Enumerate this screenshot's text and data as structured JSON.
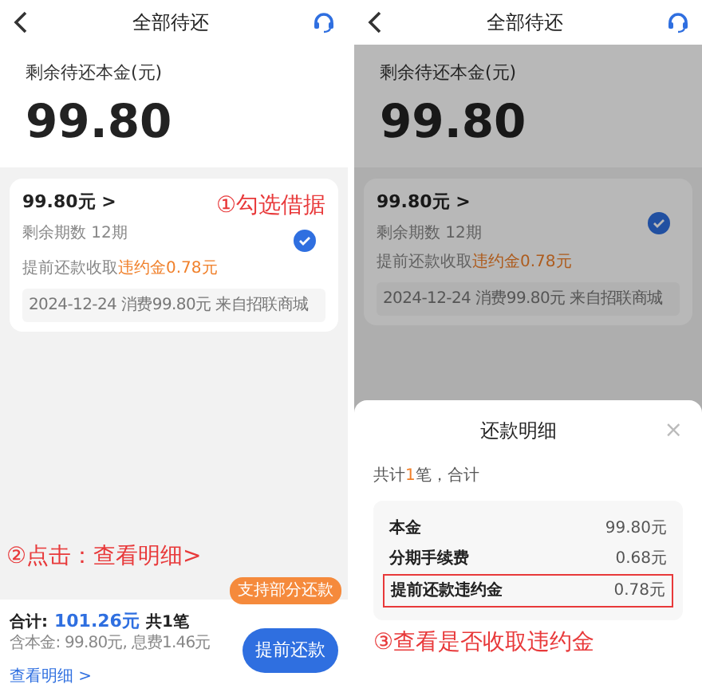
{
  "screens": [
    {
      "dimmed": false,
      "title": "全部待还",
      "summary": {
        "label": "剩余待还本金(元)",
        "amount": "99.80"
      },
      "loan": {
        "amount": "99.80元",
        "caret": ">",
        "periods": "剩余期数 12期",
        "fee_text": "提前还款收取",
        "fee_value": "违约金0.78元",
        "checked": true,
        "detail": "2024-12-24 消费99.80元 来自招联商城"
      },
      "card_annotation": "①勾选借据",
      "bottom_annotation": "②点击：查看明细>",
      "bottom_bar": {
        "total_label": "合计:",
        "total": "101.26元",
        "count": "共1笔",
        "breakdown": "含本金: 99.80元, 息费1.46元",
        "detail_link": "查看明细 >",
        "badge": "支持部分还款",
        "button": "提前还款"
      }
    },
    {
      "dimmed": true,
      "title": "全部待还",
      "summary": {
        "label": "剩余待还本金(元)",
        "amount": "99.80"
      },
      "loan": {
        "amount": "99.80元",
        "caret": ">",
        "periods": "剩余期数 12期",
        "fee_text": "提前还款收取",
        "fee_value": "违约金0.78元",
        "checked": true,
        "detail": "2024-12-24 消费99.80元 来自招联商城"
      },
      "sheet": {
        "title": "还款明细",
        "close": "×",
        "summary_before": "共计",
        "summary_count": "1",
        "summary_after": "笔，合计",
        "rows": [
          {
            "label": "本金",
            "value": "99.80元",
            "highlighted": false
          },
          {
            "label": "分期手续费",
            "value": "0.68元",
            "highlighted": false
          },
          {
            "label": "提前还款违约金",
            "value": "0.78元",
            "highlighted": true
          }
        ],
        "annotation": "③查看是否收取违约金"
      }
    }
  ]
}
